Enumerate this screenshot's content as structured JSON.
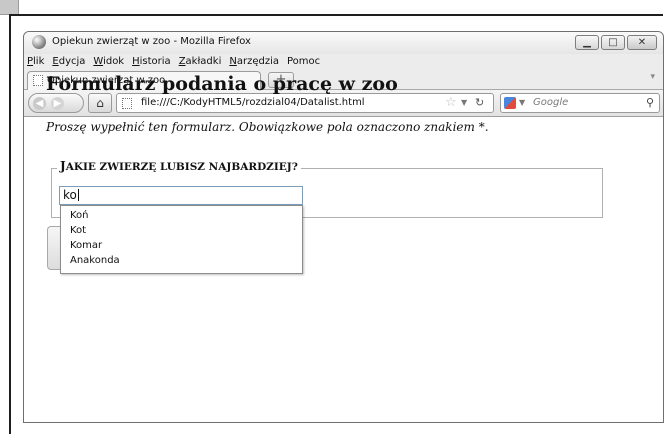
{
  "window": {
    "title": "Opiekun zwierząt w zoo - Mozilla Firefox"
  },
  "menubar": {
    "items": [
      {
        "key": "P",
        "rest": "lik"
      },
      {
        "key": "E",
        "rest": "dycja"
      },
      {
        "key": "W",
        "rest": "idok"
      },
      {
        "key": "H",
        "rest": "istoria"
      },
      {
        "key": "Z",
        "rest": "akładki"
      },
      {
        "key": "N",
        "rest": "arzędzia"
      },
      {
        "key": "",
        "rest": "Pomoc"
      }
    ]
  },
  "tabs": {
    "active_label": "Opiekun zwierząt w zoo",
    "new_tab_symbol": "+"
  },
  "navbar": {
    "url": "file:///C:/KodyHTML5/rozdzial04/Datalist.html",
    "search_placeholder": "Google"
  },
  "page": {
    "title": "Formularz podania o pracę w zoo",
    "intro": "Proszę wypełnić ten formularz. Obowiązkowe pola oznaczono znakiem *.",
    "legend_initial": "J",
    "legend_rest": "AKIE ZWIERZĘ LUBISZ NAJBARDZIEJ?",
    "input_value": "ko",
    "datalist_options": [
      "Koń",
      "Kot",
      "Komar",
      "Anakonda"
    ]
  }
}
